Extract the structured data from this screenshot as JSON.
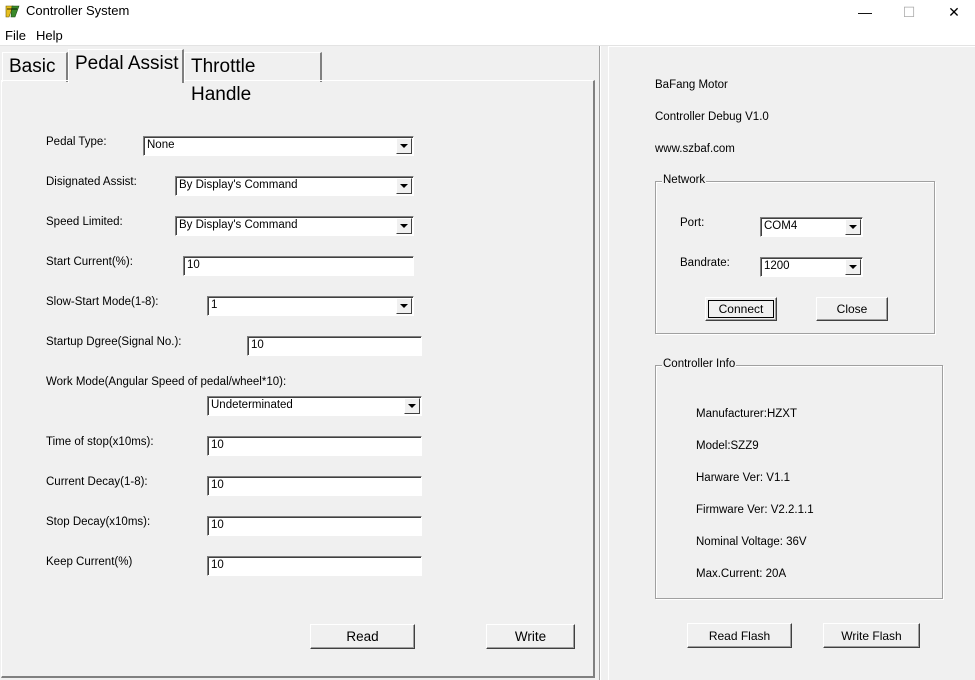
{
  "window": {
    "title": "Controller System",
    "minimize": "—",
    "maximize": "☐",
    "close": "✕"
  },
  "menu": [
    "File",
    "Help"
  ],
  "tabs": [
    "Basic",
    "Pedal Assist",
    "Throttle Handle"
  ],
  "active_tab": "Pedal Assist",
  "pedal_assist": {
    "pedal_type": {
      "label": "Pedal Type:",
      "value": "None"
    },
    "designated_assist": {
      "label": "Disignated Assist:",
      "value": "By Display's Command"
    },
    "speed_limited": {
      "label": "Speed Limited:",
      "value": "By Display's Command"
    },
    "start_current": {
      "label": "Start Current(%):",
      "value": "10"
    },
    "slow_start_mode": {
      "label": "Slow-Start Mode(1-8):",
      "value": "1"
    },
    "startup_degree": {
      "label": "Startup Dgree(Signal No.):",
      "value": "10"
    },
    "work_mode": {
      "label": "Work Mode(Angular Speed of pedal/wheel*10):",
      "value": "Undeterminated"
    },
    "time_of_stop": {
      "label": "Time of stop(x10ms):",
      "value": "10"
    },
    "current_decay": {
      "label": "Current Decay(1-8):",
      "value": "10"
    },
    "stop_decay": {
      "label": "Stop Decay(x10ms):",
      "value": "10"
    },
    "keep_current": {
      "label": "Keep Current(%)",
      "value": "10"
    },
    "read_button": "Read",
    "write_button": "Write"
  },
  "about": {
    "line1": "BaFang Motor",
    "line2": "Controller Debug V1.0",
    "line3": "www.szbaf.com"
  },
  "network": {
    "title": "Network",
    "port_label": "Port:",
    "port_value": "COM4",
    "baud_label": "Bandrate:",
    "baud_value": "1200",
    "connect_button": "Connect",
    "close_button": "Close"
  },
  "controller_info": {
    "title": "Controller Info",
    "manufacturer": "Manufacturer:HZXT",
    "model": "Model:SZZ9",
    "hardware": "Harware Ver: V1.1",
    "firmware": "Firmware Ver: V2.2.1.1",
    "voltage": "Nominal Voltage: 36V",
    "max_current": "Max.Current: 20A"
  },
  "flash": {
    "read_button": "Read Flash",
    "write_button": "Write Flash"
  },
  "colors": {
    "window_bg": "#f0f0f0",
    "field_bg": "#ffffff",
    "icon_yellow": "#e8c020"
  }
}
